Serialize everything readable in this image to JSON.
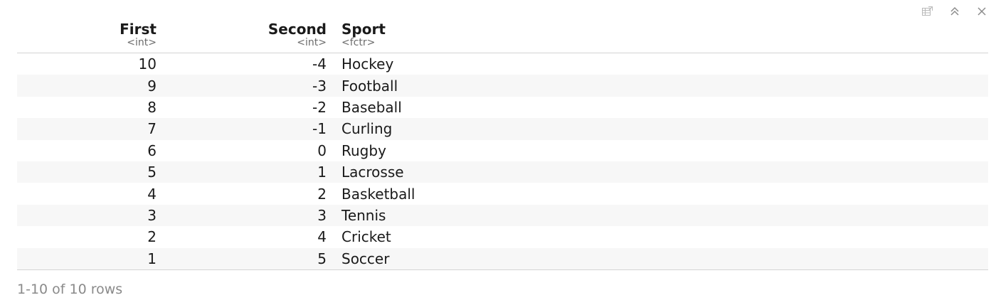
{
  "toolbar": {
    "icons": [
      "export-data-icon",
      "collapse-chevrons-icon",
      "close-icon"
    ]
  },
  "table": {
    "columns": [
      {
        "name": "First",
        "type": "<int>"
      },
      {
        "name": "Second",
        "type": "<int>"
      },
      {
        "name": "Sport",
        "type": "<fctr>"
      }
    ],
    "rows": [
      {
        "first": "10",
        "second": "-4",
        "sport": "Hockey"
      },
      {
        "first": "9",
        "second": "-3",
        "sport": "Football"
      },
      {
        "first": "8",
        "second": "-2",
        "sport": "Baseball"
      },
      {
        "first": "7",
        "second": "-1",
        "sport": "Curling"
      },
      {
        "first": "6",
        "second": "0",
        "sport": "Rugby"
      },
      {
        "first": "5",
        "second": "1",
        "sport": "Lacrosse"
      },
      {
        "first": "4",
        "second": "2",
        "sport": "Basketball"
      },
      {
        "first": "3",
        "second": "3",
        "sport": "Tennis"
      },
      {
        "first": "2",
        "second": "4",
        "sport": "Cricket"
      },
      {
        "first": "1",
        "second": "5",
        "sport": "Soccer"
      }
    ]
  },
  "footer": {
    "row_summary": "1-10 of 10 rows"
  },
  "colors": {
    "stripe": "#f7f7f7",
    "border": "#d4d4d4",
    "muted_text": "#8a8a8a",
    "icon": "#b0b0b0"
  }
}
